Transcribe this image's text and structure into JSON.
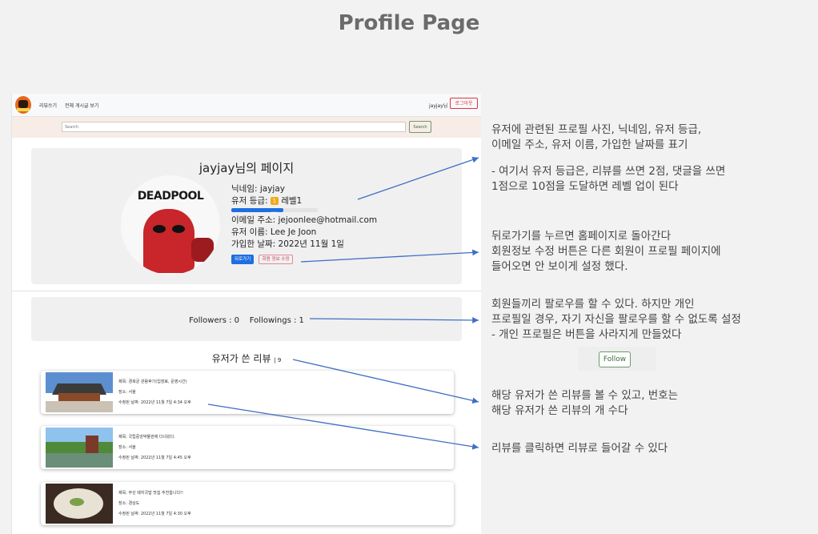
{
  "slide_title": "Profile Page",
  "navbar": {
    "links": [
      "리뷰쓰기",
      "전체 게시글 보기"
    ],
    "username": "jayjay님",
    "logout_label": "로그아웃"
  },
  "search": {
    "placeholder": "Search",
    "button_label": "Search"
  },
  "profile": {
    "heading": "jayjay님의 페이지",
    "avatar_text": "DEADPOOL",
    "nickname": "닉네임: jayjay",
    "grade_label": "유저 등급:",
    "grade_badge": "1",
    "grade_value": "레벨1",
    "progress_fraction": 0.6,
    "progress_label": "60%",
    "email": "이메일 주소: jejoonlee@hotmail.com",
    "name": "유저 이름: Lee Je Joon",
    "joined": "가입한 날짜: 2022년 11월 1일",
    "back_button": "뒤로가기",
    "edit_button": "회원 정보 수정"
  },
  "follow": {
    "text": "Followers : 0    Followings : 1"
  },
  "reviews": {
    "heading": "유저가 쓴 리뷰",
    "count": "| 9",
    "items": [
      {
        "title": "제목: 경복궁 관람후기(입장료, 운영시간)",
        "place": "장소: 서울",
        "date": "수정된 날짜: 2022년 11월 7일 4:34 오후"
      },
      {
        "title": "제목: 국립중앙박물관에 다녀왔다.",
        "place": "장소: 서울",
        "date": "수정된 날짜: 2022년 11월 7일 4:45 오후"
      },
      {
        "title": "제목: 부산 돼지국밥 맛집 추천합니다!!",
        "place": "장소: 경상도",
        "date": "수정된 날짜: 2022년 11월 7일 4:30 오후"
      }
    ]
  },
  "notes": {
    "n1_line1": "유저에 관련된 프로필 사진, 닉네임, 유저 등급,",
    "n1_line2": "이메일 주소, 유저 이름, 가입한 날짜를 표기",
    "n1_line3": "- 여기서 유저 등급은, 리뷰를 쓰면 2점, 댓글을 쓰면",
    "n1_line4": "1점으로 10점을 도달하면 레벨 업이 된다",
    "n2_line1": "뒤로가기를 누르면 홈페이지로 돌아간다",
    "n2_line2": "회원정보 수정 버튼은 다른 회원이 프로필 페이지에",
    "n2_line3": "들어오면 안 보이게 설정 했다.",
    "n3_line1": "회원들끼리 팔로우를 할 수 있다. 하지만 개인",
    "n3_line2": "프로필일 경우, 자기 자신을 팔로우를 할 수 없도록 설정",
    "n3_line3": "- 개인 프로필은 버튼을 사라지게 만들었다",
    "follow_button": "Follow",
    "n4_line1": "해당 유저가 쓴 리뷰를 볼 수 있고, 번호는",
    "n4_line2": "해당 유저가 쓴 리뷰의 개 수다",
    "n5_line1": "리뷰를 클릭하면 리뷰로 들어갈 수 있다"
  },
  "colors": {
    "arrow": "#3f6fc4",
    "primary_button": "#1e6fe0",
    "search_bar_bg": "#f7ece6"
  }
}
